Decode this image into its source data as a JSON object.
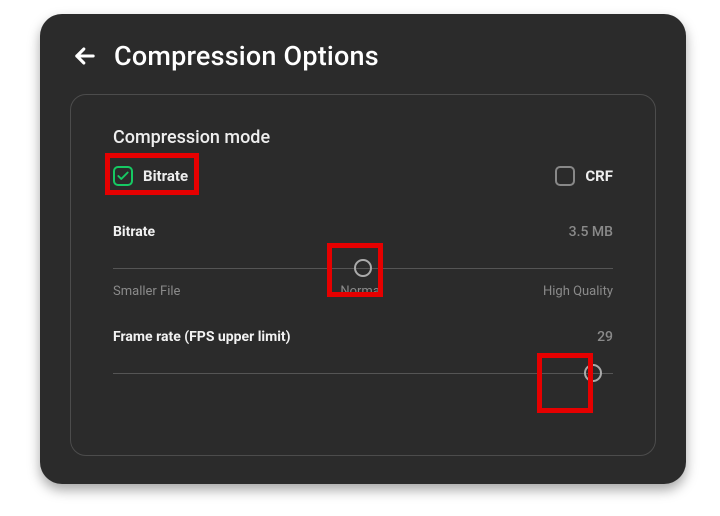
{
  "header": {
    "title": "Compression Options"
  },
  "card": {
    "section_label": "Compression mode",
    "modes": {
      "bitrate": {
        "label": "Bitrate",
        "checked": true
      },
      "crf": {
        "label": "CRF",
        "checked": false
      }
    },
    "bitrate_slider": {
      "name": "Bitrate",
      "value": "3.5 MB",
      "ticks": {
        "low": "Smaller File",
        "mid": "Normal",
        "high": "High Quality"
      },
      "pos_pct": 50
    },
    "fps_slider": {
      "name": "Frame rate (FPS upper limit)",
      "value": "29",
      "pos_pct": 96
    }
  }
}
